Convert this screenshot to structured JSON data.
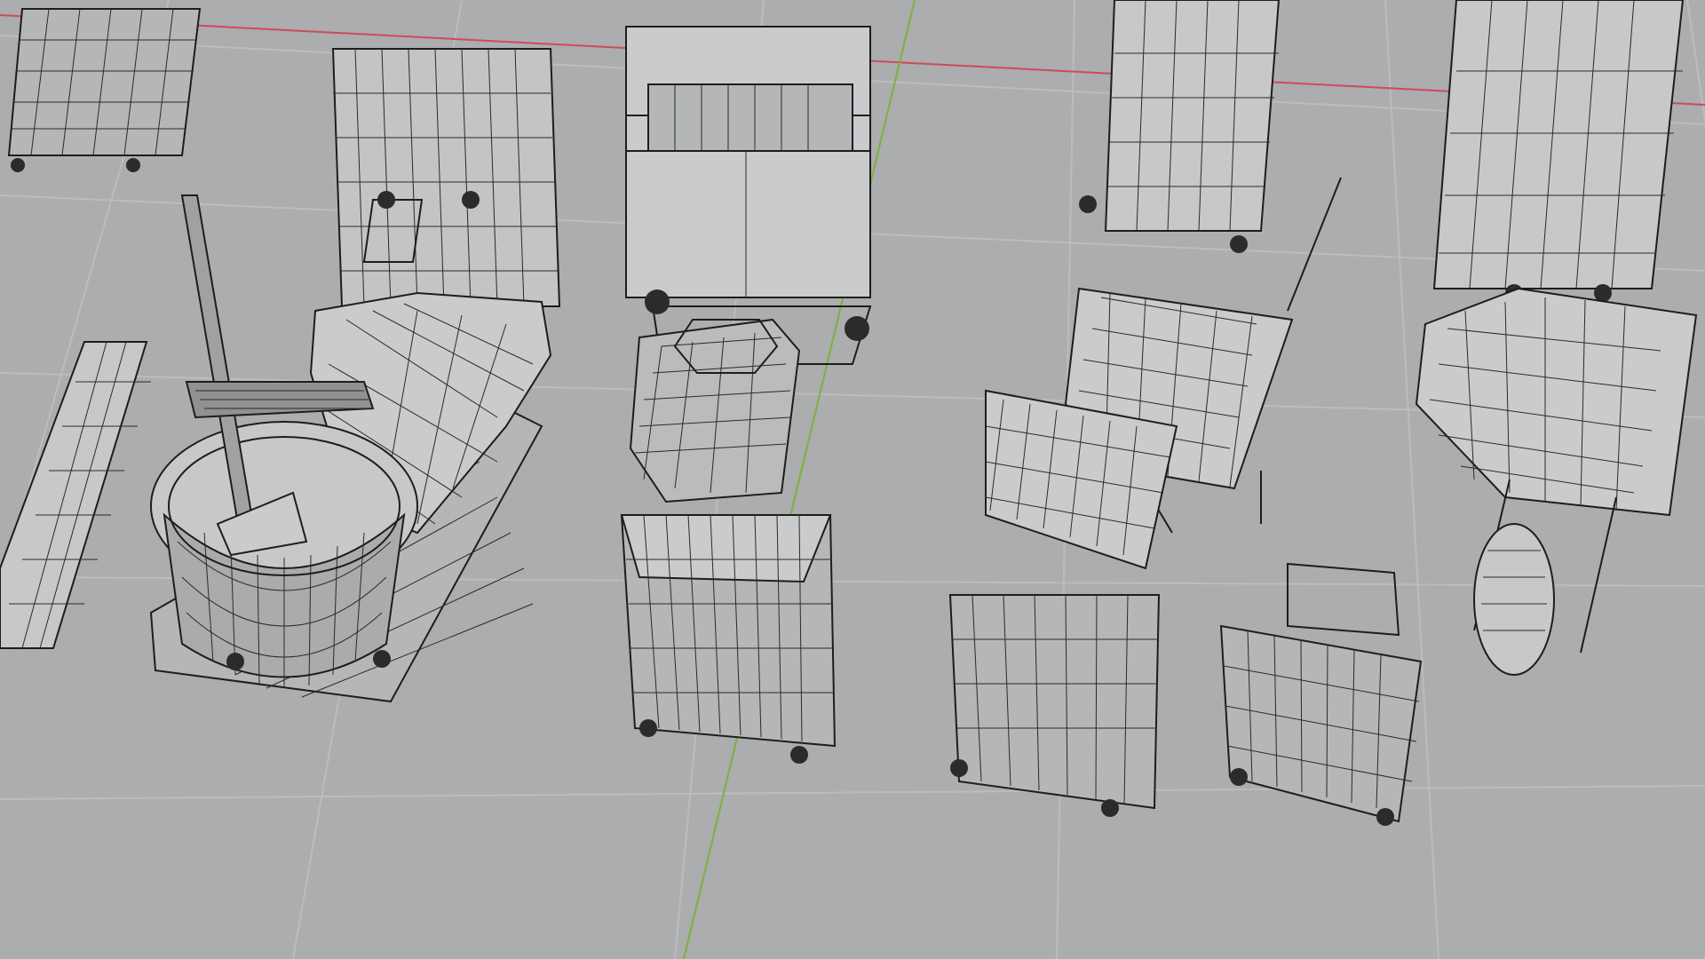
{
  "viewport": {
    "background": "#abadaf",
    "grid_color": "#bcbec0",
    "axis_x_color": "#d0495a",
    "axis_y_color": "#7bb23a",
    "wire_color": "#1d1d1d",
    "surface_light": "#c9cbcd",
    "surface_mid": "#b4b6b8",
    "surface_dark": "#9fa1a3"
  },
  "objects": [
    {
      "name": "platform-cart-folded"
    },
    {
      "name": "hand-truck-top"
    },
    {
      "name": "shopping-cart-tall"
    },
    {
      "name": "hand-truck-right"
    },
    {
      "name": "hand-truck-far-right"
    },
    {
      "name": "hand-truck-left-partial"
    },
    {
      "name": "cleaning-cart-with-bucket-and-mop"
    },
    {
      "name": "folding-trolley-handle"
    },
    {
      "name": "crate-cart-closed"
    },
    {
      "name": "wheelbarrow-middle"
    },
    {
      "name": "crate-cart-open-lid"
    },
    {
      "name": "crate-cart-small"
    },
    {
      "name": "wheelbarrow-right"
    }
  ]
}
